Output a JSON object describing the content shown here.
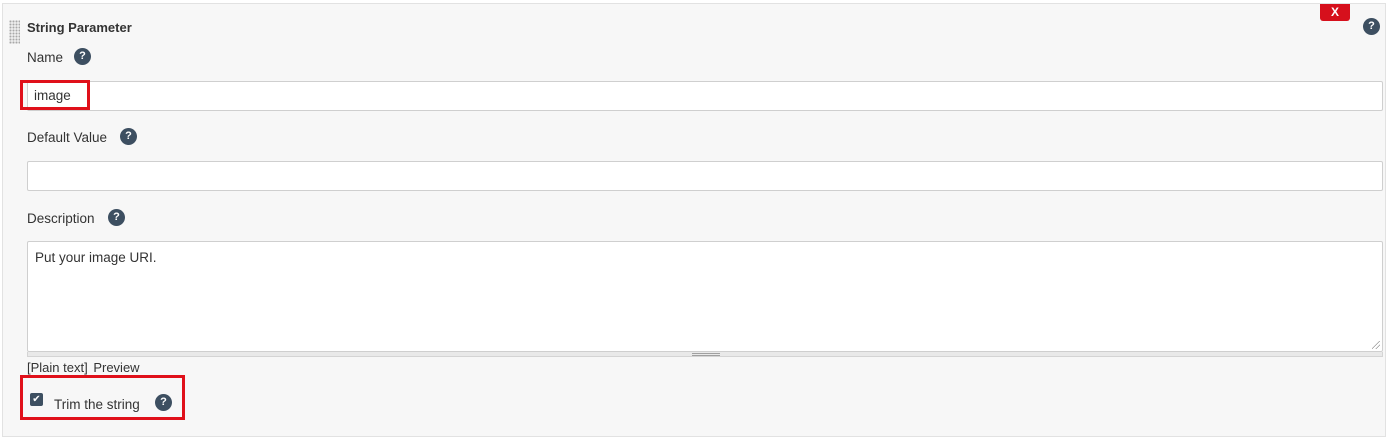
{
  "section": {
    "title": "String Parameter",
    "delete_label": "X",
    "help_glyph": "?"
  },
  "fields": {
    "name": {
      "label": "Name",
      "value": "image",
      "help_glyph": "?"
    },
    "default_value": {
      "label": "Default Value",
      "value": "",
      "help_glyph": "?"
    },
    "description": {
      "label": "Description",
      "value": "Put your image URI.",
      "help_glyph": "?"
    }
  },
  "format": {
    "current": "[Plain text]",
    "preview_label": "Preview"
  },
  "trim": {
    "label": "Trim the string",
    "checked": true,
    "check_glyph": "✔",
    "help_glyph": "?"
  },
  "colors": {
    "delete_button": "#d6101c",
    "help_icon": "#3d4f61",
    "highlight_annotation": "#e0101a"
  },
  "icons": {
    "drag_handle": "drag-handle-icon",
    "help": "help-icon",
    "delete": "close-icon",
    "checkbox": "checkmark-icon"
  }
}
